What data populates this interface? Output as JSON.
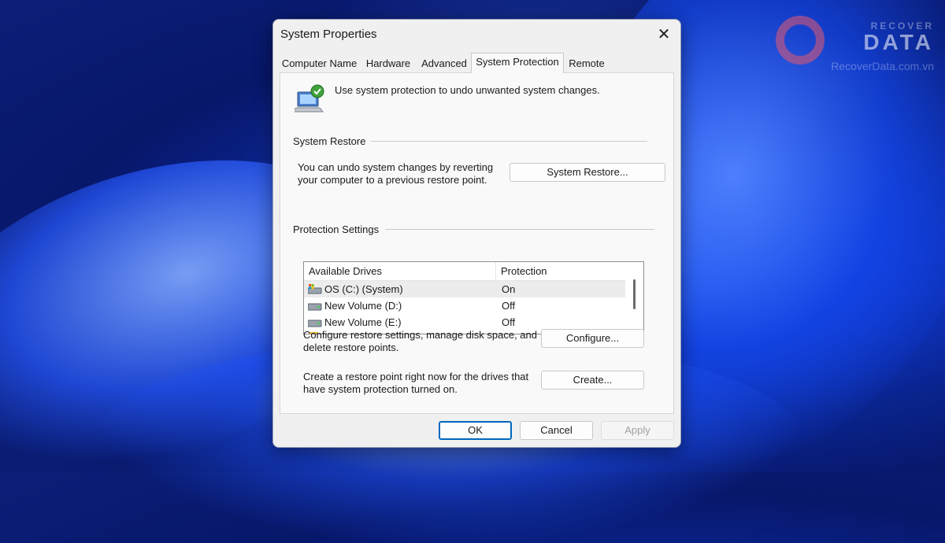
{
  "watermark": {
    "top": "RECOVER",
    "main": "DATA",
    "sub": "RecoverData.com.vn"
  },
  "dialog": {
    "title": "System Properties",
    "close_glyph": "✕",
    "tabs": [
      {
        "label": "Computer Name",
        "active": false
      },
      {
        "label": "Hardware",
        "active": false
      },
      {
        "label": "Advanced",
        "active": false
      },
      {
        "label": "System Protection",
        "active": true
      },
      {
        "label": "Remote",
        "active": false
      }
    ],
    "intro": "Use system protection to undo unwanted system changes.",
    "system_restore": {
      "group_label": "System Restore",
      "description_line1": "You can undo system changes by reverting",
      "description_line2": "your computer to a previous restore point.",
      "button_label": "System Restore..."
    },
    "protection_settings": {
      "group_label": "Protection Settings",
      "columns": [
        "Available Drives",
        "Protection"
      ],
      "drives": [
        {
          "name": "OS (C:) (System)",
          "protection": "On",
          "icon": "system-drive-icon",
          "selected": true
        },
        {
          "name": "New Volume (D:)",
          "protection": "Off",
          "icon": "drive-icon",
          "selected": false
        },
        {
          "name": "New Volume (E:)",
          "protection": "Off",
          "icon": "drive-icon",
          "selected": false
        }
      ],
      "configure_line1": "Configure restore settings, manage disk space, and",
      "configure_line2": "delete restore points.",
      "configure_label": "Configure...",
      "create_line1": "Create a restore point right now for the drives that",
      "create_line2": "have system protection turned on.",
      "create_label": "Create..."
    },
    "buttons": {
      "ok": "OK",
      "cancel": "Cancel",
      "apply": "Apply"
    }
  },
  "colors": {
    "accent": "#0067c0",
    "disabled_text": "#a0a0a0",
    "selection": "#ececec"
  }
}
